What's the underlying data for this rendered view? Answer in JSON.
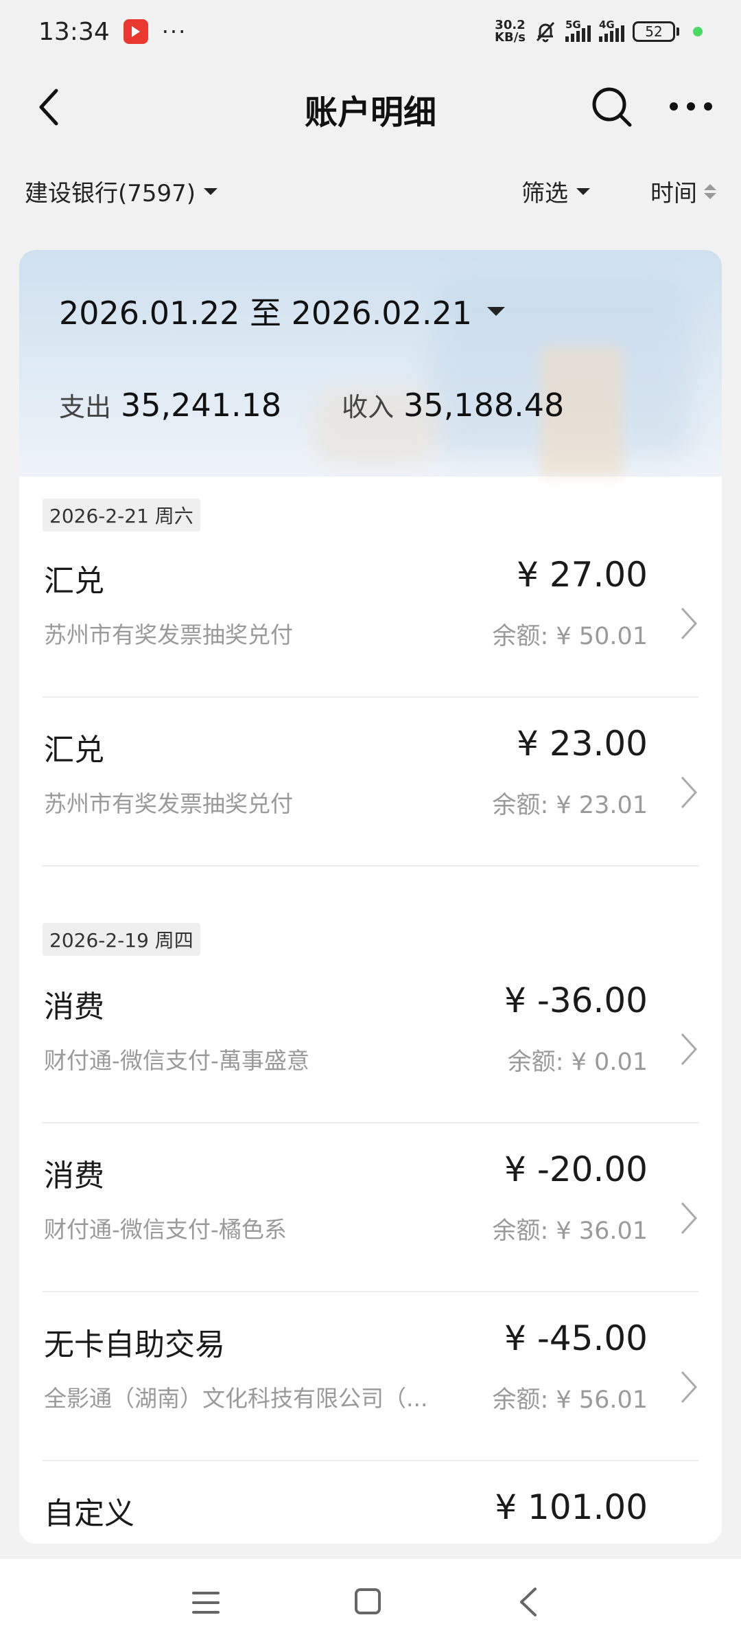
{
  "status_bar": {
    "time": "13:34",
    "dots": "···",
    "net_speed_value": "30.2",
    "net_speed_unit": "KB/s",
    "signal1_label": "5G",
    "signal2_label": "4G",
    "battery": "52"
  },
  "header": {
    "title": "账户明细",
    "icons": [
      "back-icon",
      "search-icon",
      "more-icon"
    ]
  },
  "filter": {
    "account": "建设银行(7597)",
    "filter_label": "筛选",
    "time_label": "时间"
  },
  "summary": {
    "date_range": "2026.01.22 至 2026.02.21",
    "expense_label": "支出",
    "expense_value": "35,241.18",
    "income_label": "收入",
    "income_value": "35,188.48"
  },
  "groups": [
    {
      "date": "2026-2-21 周六",
      "transactions": [
        {
          "type": "汇兑",
          "desc": "苏州市有奖发票抽奖兑付",
          "amount": "¥ 27.00",
          "balance": "余额: ¥ 50.01"
        },
        {
          "type": "汇兑",
          "desc": "苏州市有奖发票抽奖兑付",
          "amount": "¥ 23.00",
          "balance": "余额: ¥ 23.01"
        }
      ]
    },
    {
      "date": "2026-2-19 周四",
      "transactions": [
        {
          "type": "消费",
          "desc": "财付通-微信支付-萬事盛意",
          "amount": "¥ -36.00",
          "balance": "余额: ¥ 0.01"
        },
        {
          "type": "消费",
          "desc": "财付通-微信支付-橘色系",
          "amount": "¥ -20.00",
          "balance": "余额: ¥ 36.01"
        },
        {
          "type": "无卡自助交易",
          "desc": "全影通（湖南）文化科技有限公司（...",
          "amount": "¥ -45.00",
          "balance": "余额: ¥ 56.01"
        },
        {
          "type": "自定义",
          "desc": "",
          "amount": "¥ 101.00",
          "balance": ""
        }
      ]
    }
  ],
  "bottom_nav": [
    "menu-icon",
    "home-icon",
    "back-icon"
  ]
}
